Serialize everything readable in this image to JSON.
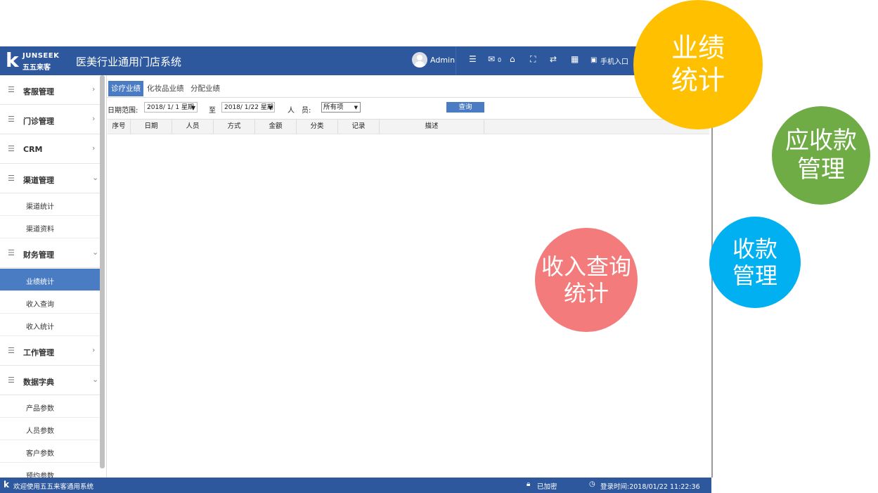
{
  "header": {
    "logo_brand": "JUNSEEK",
    "logo_cn": "五五来客",
    "app_title": "医美行业通用门店系统",
    "user_name": "Admin",
    "mail_count": "0",
    "mobile_entry": "手机入口"
  },
  "sidebar": {
    "groups": [
      {
        "label": "客服管理",
        "arrow": "›"
      },
      {
        "label": "门诊管理",
        "arrow": "›"
      },
      {
        "label": "CRM",
        "arrow": "›"
      },
      {
        "label": "渠道管理",
        "arrow": "⌄"
      },
      {
        "label": "财务管理",
        "arrow": "⌄"
      },
      {
        "label": "工作管理",
        "arrow": "›"
      },
      {
        "label": "数据字典",
        "arrow": "⌄"
      }
    ],
    "channel_items": [
      "渠道统计",
      "渠道资料"
    ],
    "finance_items": [
      "业绩统计",
      "收入查询",
      "收入统计"
    ],
    "dict_items": [
      "产品参数",
      "人员参数",
      "客户参数",
      "预约参数"
    ]
  },
  "main": {
    "tabs": [
      "诊疗业绩",
      "化妆品业绩",
      "分配业绩"
    ],
    "filter": {
      "date_range_label": "日期范围:",
      "start_date": "2018/ 1/ 1 星期",
      "to_label": "至",
      "end_date": "2018/ 1/22 星期",
      "person_label": "人　员:",
      "person_value": "所有项",
      "query_button": "查询"
    },
    "columns": [
      "序号",
      "日期",
      "人员",
      "方式",
      "金额",
      "分类",
      "记录",
      "描述"
    ]
  },
  "statusbar": {
    "welcome": "欢迎使用五五来客通用系统",
    "encrypted": "已加密",
    "login_time": "登录时间:2018/01/22 11:22:36"
  },
  "bubbles": {
    "yellow": [
      "业绩",
      "统计"
    ],
    "green": [
      "应收款",
      "管理"
    ],
    "blue": [
      "收款",
      "管理"
    ],
    "red": [
      "收入查询",
      "统计"
    ]
  },
  "colors": {
    "header_blue": "#2e589e",
    "active_blue": "#4a7cc4",
    "yellow": "#ffc000",
    "green": "#6fac46",
    "cyan": "#00b0f0",
    "pink": "#f47b7b"
  }
}
